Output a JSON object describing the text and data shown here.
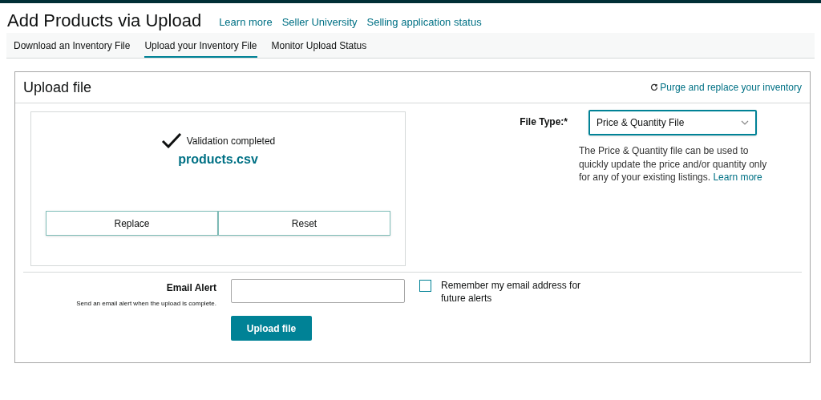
{
  "page": {
    "title": "Add Products via Upload",
    "links": [
      "Learn more",
      "Seller University",
      "Selling application status"
    ]
  },
  "tabs": [
    {
      "label": "Download an Inventory File",
      "selected": false
    },
    {
      "label": "Upload your Inventory File",
      "selected": true
    },
    {
      "label": "Monitor Upload Status",
      "selected": false
    }
  ],
  "panel": {
    "title": "Upload file",
    "purge_link": "Purge and replace your inventory"
  },
  "upload": {
    "status": "Validation completed",
    "file_name": "products.csv",
    "buttons": [
      "Replace",
      "Reset"
    ]
  },
  "file_type": {
    "label": "File Type:*",
    "value": "Price & Quantity File",
    "description": "The Price & Quantity file can be used to quickly update the price and/or quantity only for any of your existing listings.",
    "link": "Learn more"
  },
  "email_alert": {
    "label": "Email Alert",
    "hint": "Send an email alert when the upload is complete.",
    "remember": {
      "label": "Remember my email address for future alerts",
      "checked": false
    }
  },
  "submit": "Upload file"
}
